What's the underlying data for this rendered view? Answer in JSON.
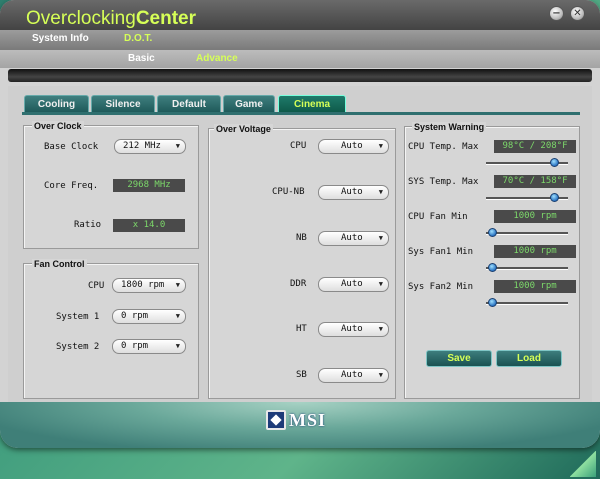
{
  "app": {
    "title_part1": "Overclocking",
    "title_part2": "Center",
    "minimize_glyph": "−",
    "close_glyph": "✕"
  },
  "menu": {
    "system_info": "System Info",
    "dot": "D.O.T."
  },
  "submenu": {
    "basic": "Basic",
    "advance": "Advance"
  },
  "tabs": [
    {
      "label": "Cooling",
      "active": false
    },
    {
      "label": "Silence",
      "active": false
    },
    {
      "label": "Default",
      "active": false
    },
    {
      "label": "Game",
      "active": false
    },
    {
      "label": "Cinema",
      "active": true
    }
  ],
  "overclock": {
    "title": "Over Clock",
    "base_clock_label": "Base Clock",
    "base_clock_value": "212 MHz",
    "core_freq_label": "Core Freq.",
    "core_freq_value": "2968 MHz",
    "ratio_label": "Ratio",
    "ratio_value": "x 14.0"
  },
  "fan_control": {
    "title": "Fan Control",
    "cpu_label": "CPU",
    "cpu_value": "1800 rpm",
    "system1_label": "System 1",
    "system1_value": "0 rpm",
    "system2_label": "System 2",
    "system2_value": "0 rpm"
  },
  "over_voltage": {
    "title": "Over Voltage",
    "items": [
      {
        "label": "CPU",
        "value": "Auto"
      },
      {
        "label": "CPU-NB",
        "value": "Auto"
      },
      {
        "label": "NB",
        "value": "Auto"
      },
      {
        "label": "DDR",
        "value": "Auto"
      },
      {
        "label": "HT",
        "value": "Auto"
      },
      {
        "label": "SB",
        "value": "Auto"
      }
    ]
  },
  "system_warning": {
    "title": "System Warning",
    "items": [
      {
        "label": "CPU Temp. Max",
        "value": "98°C / 208°F",
        "level": 0.88
      },
      {
        "label": "SYS Temp. Max",
        "value": "70°C / 158°F",
        "level": 0.88
      },
      {
        "label": "CPU Fan Min",
        "value": "1000 rpm",
        "level": 0.03
      },
      {
        "label": "Sys Fan1 Min",
        "value": "1000 rpm",
        "level": 0.03
      },
      {
        "label": "Sys Fan2 Min",
        "value": "1000 rpm",
        "level": 0.03
      }
    ],
    "save_label": "Save",
    "load_label": "Load"
  },
  "brand": {
    "logo_text": "MSI"
  },
  "colors": {
    "accent_green": "#d6ff57",
    "readout_green": "#7cd86a",
    "teal": "#2f6f6f"
  }
}
